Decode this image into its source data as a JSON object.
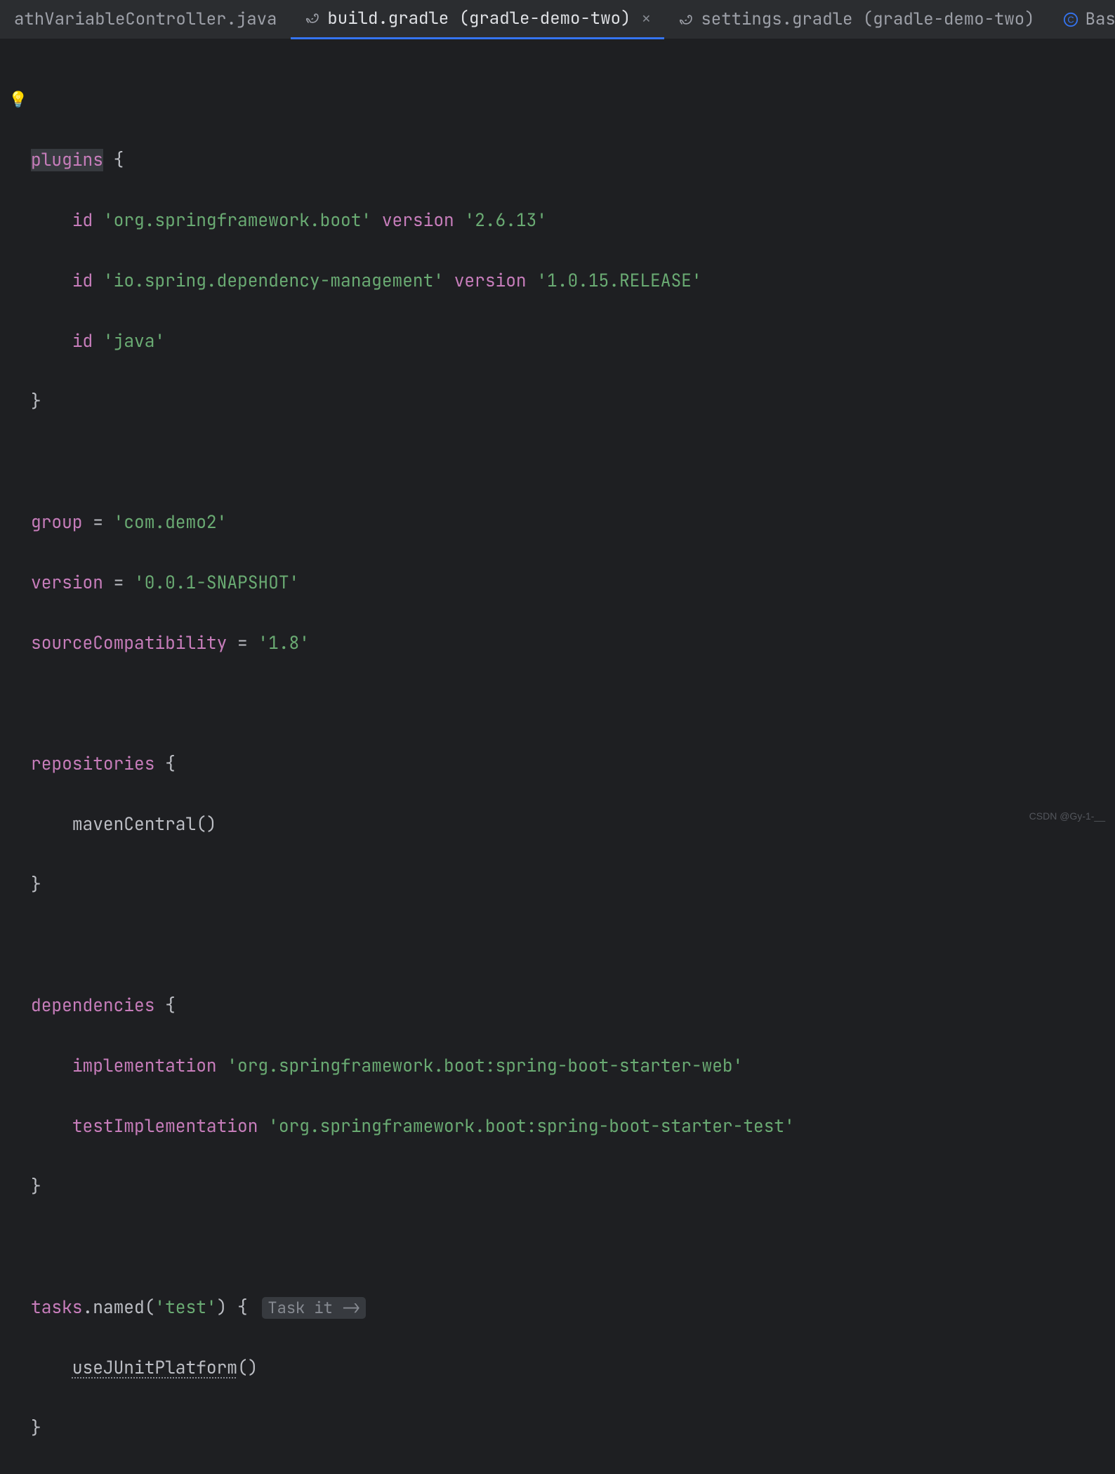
{
  "tabs": {
    "t0": {
      "label": "athVariableController.java"
    },
    "t1": {
      "label": "build.gradle (gradle-demo-two)"
    },
    "t2": {
      "label": "settings.gradle (gradle-demo-two)"
    },
    "t3": {
      "label": "BasicCo"
    }
  },
  "code": {
    "plugins_kw": "plugins",
    "id_kw": "id",
    "version_kw": "version",
    "boot_plugin": "'org.springframework.boot'",
    "boot_ver": "'2.6.13'",
    "dm_plugin": "'io.spring.dependency-management'",
    "dm_ver": "'1.0.15.RELEASE'",
    "java_plugin": "'java'",
    "group_kw": "group",
    "group_val": "'com.demo2'",
    "version_prop": "version",
    "version_val": "'0.0.1-SNAPSHOT'",
    "sc_kw": "sourceCompatibility",
    "sc_val": "'1.8'",
    "repos_kw": "repositories",
    "maven_fn": "mavenCentral",
    "deps_kw": "dependencies",
    "impl_kw": "implementation",
    "impl_val": "'org.springframework.boot:spring-boot-starter-web'",
    "timpl_kw": "testImplementation",
    "timpl_val": "'org.springframework.boot:spring-boot-starter-test'",
    "tasks_kw": "tasks",
    "named_fn": "named",
    "named_arg": "'test'",
    "hint": "Task it ->",
    "junit_fn": "useJUnitPlatform"
  },
  "watermark": "CSDN @Gy-1-__"
}
